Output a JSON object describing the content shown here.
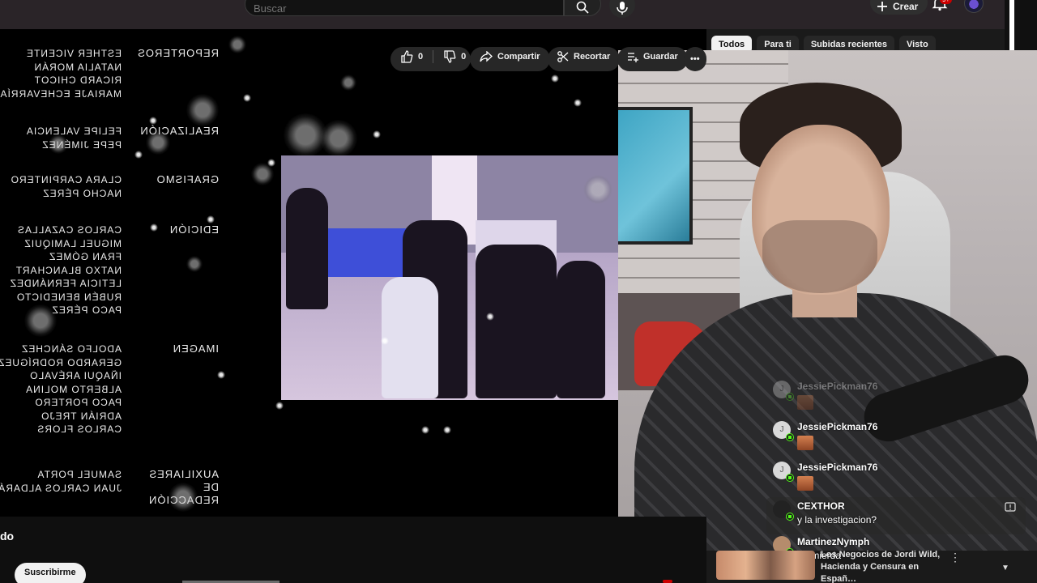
{
  "header": {
    "search_placeholder": "Buscar",
    "create_label": "Crear",
    "notifications_badge": "9+"
  },
  "chips": [
    "Todos",
    "Para ti",
    "Subidas recientes",
    "Visto"
  ],
  "credits": [
    {
      "role": "Reporteros",
      "names": [
        "Esther Vicente",
        "Natalia Morán",
        "Ricard Chicot",
        "Mariaje Echevarría"
      ]
    },
    {
      "role": "Realización",
      "names": [
        "Felipe Valencia",
        "Pepe Jiménez"
      ]
    },
    {
      "role": "Grafismo",
      "names": [
        "Clara Carpintero",
        "Nacho Pérez"
      ]
    },
    {
      "role": "Edición",
      "names": [
        "Carlos Cazallas",
        "Miguel Lamiquiz",
        "Fran Gómez",
        "Natxo Blanchart",
        "Leticia Fernández",
        "Rubén Benedicto",
        "Paco Pérez"
      ]
    },
    {
      "role": "Imagen",
      "names": [
        "Adolfo Sánchez",
        "Gerardo Rodríguez",
        "Iñaqui Arévalo",
        "Alberto Molina",
        "Paco Portero",
        "Adrián Trejo",
        "Carlos Flors"
      ]
    },
    {
      "role": "Auxiliares de redacción",
      "names": [
        "Samuel Porta",
        "Juan Carlos Aldará"
      ]
    }
  ],
  "chat": [
    {
      "user": "JessiePickman76",
      "text": "",
      "avatar": "J",
      "emote": true,
      "faded": true
    },
    {
      "user": "JessiePickman76",
      "text": "",
      "avatar": "J",
      "emote": true,
      "faded": false
    },
    {
      "user": "JessiePickman76",
      "text": "",
      "avatar": "J",
      "emote": true,
      "faded": false
    },
    {
      "user": "CEXTHOR",
      "text": "y la investigacion?",
      "avatar": "",
      "emote": false,
      "faded": false,
      "highlight": true
    },
    {
      "user": "MartinezNymph",
      "text": "Es mierda",
      "avatar": "",
      "emote": false,
      "faded": false
    }
  ],
  "below": {
    "title_fragment": "do",
    "subscribe_label": "Suscribirme",
    "likes": "0",
    "dislikes": "0",
    "share_label": "Compartir",
    "clip_label": "Recortar",
    "save_label": "Guardar",
    "more_label": "•••"
  },
  "related": {
    "title": "Los Negocios de Jordi Wild, Hacienda y Censura en Españ…"
  },
  "colors": {
    "accent_red": "#cc0000",
    "kick_green": "#53fc18",
    "chip_active_bg": "#f1f1f1",
    "chip_bg": "#272727"
  },
  "icons": [
    "search-icon",
    "mic-icon",
    "plus-icon",
    "bell-icon",
    "like-icon",
    "dislike-icon",
    "share-icon",
    "scissors-icon",
    "save-icon",
    "more-icon",
    "kick-icon",
    "report-icon"
  ]
}
